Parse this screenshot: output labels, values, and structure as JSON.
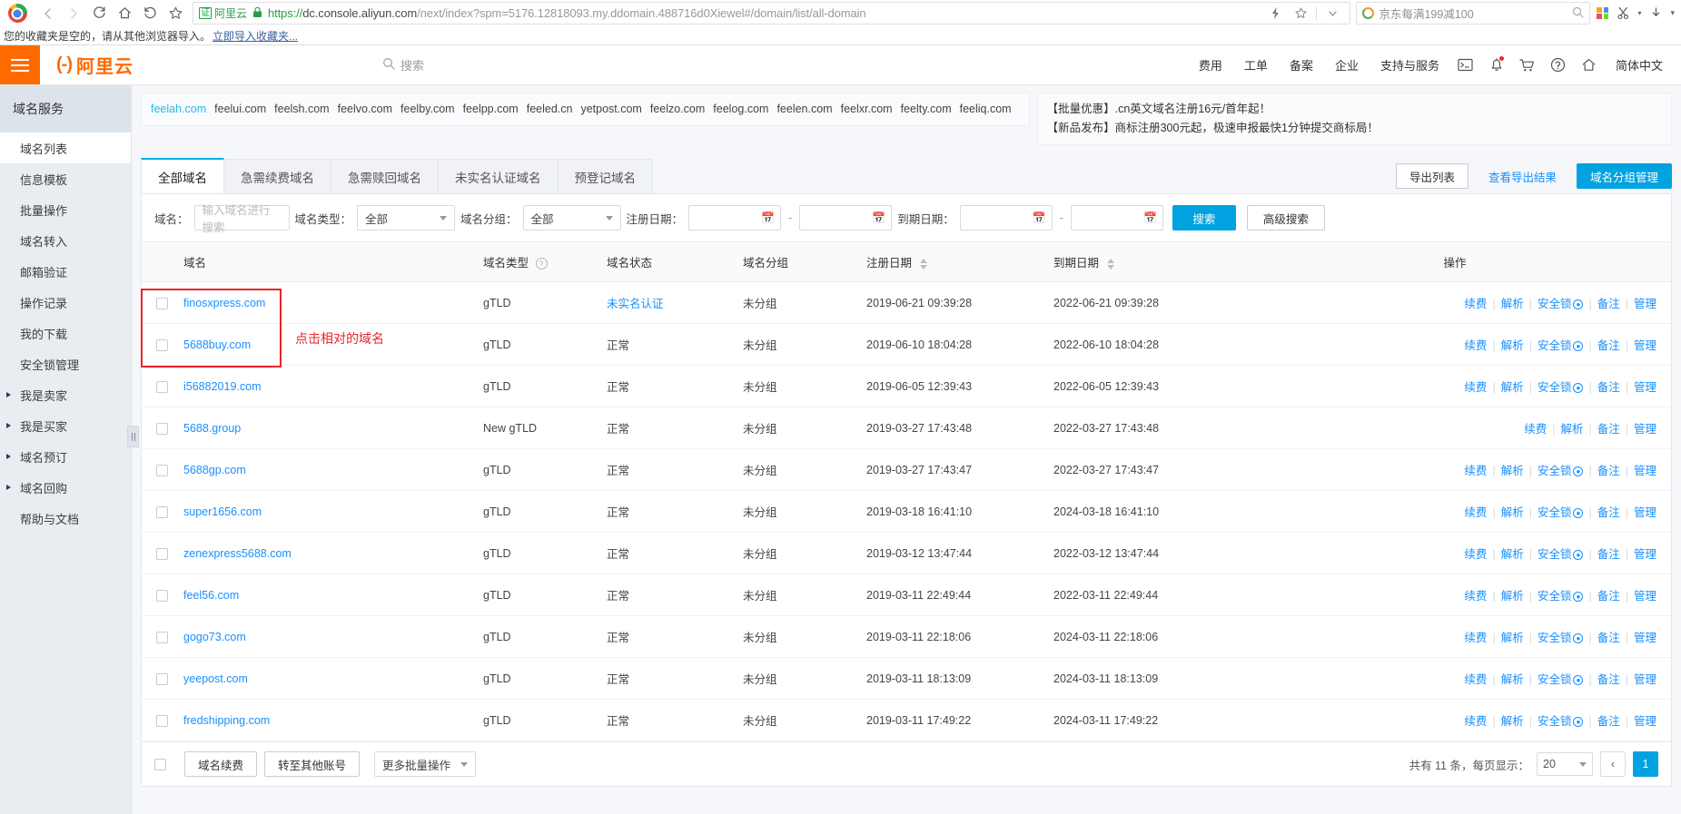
{
  "browser": {
    "back_label": "‹",
    "forward_label": "›",
    "reload_label": "⟳",
    "home_label": "⌂",
    "history_label": "↺",
    "bookmark_label": "☆",
    "cert_badge": "证",
    "cert_name": "阿里云",
    "url_scheme": "https://",
    "url_host": "dc.console.aliyun.com",
    "url_path": "/next/index?spm=5176.12818093.my.ddomain.488716d0Xiewel#/domain/list/all-domain",
    "search_box_value": "京东每满199减100",
    "bookmarks_text": "您的收藏夹是空的，请从其他浏览器导入。",
    "bookmarks_import": "立即导入收藏夹..."
  },
  "header": {
    "logo_mark": "(-)",
    "logo_text": "阿里云",
    "search_placeholder": "搜索",
    "nav_items": [
      "费用",
      "工单",
      "备案",
      "企业",
      "支持与服务"
    ],
    "icons": [
      "terminal-icon",
      "bell-icon",
      "cart-icon",
      "help-icon",
      "home-icon"
    ],
    "language": "简体中文"
  },
  "sidebar": {
    "title": "域名服务",
    "items": [
      {
        "label": "域名列表",
        "active": true,
        "expandable": false
      },
      {
        "label": "信息模板",
        "active": false,
        "expandable": false
      },
      {
        "label": "批量操作",
        "active": false,
        "expandable": false
      },
      {
        "label": "域名转入",
        "active": false,
        "expandable": false
      },
      {
        "label": "邮箱验证",
        "active": false,
        "expandable": false
      },
      {
        "label": "操作记录",
        "active": false,
        "expandable": false
      },
      {
        "label": "我的下载",
        "active": false,
        "expandable": false
      },
      {
        "label": "安全锁管理",
        "active": false,
        "expandable": false
      },
      {
        "label": "我是卖家",
        "active": false,
        "expandable": true
      },
      {
        "label": "我是买家",
        "active": false,
        "expandable": true
      },
      {
        "label": "域名预订",
        "active": false,
        "expandable": true
      },
      {
        "label": "域名回购",
        "active": false,
        "expandable": true
      },
      {
        "label": "帮助与文档",
        "active": false,
        "expandable": false
      }
    ]
  },
  "promo": {
    "domain_chips": [
      "feelah.com",
      "feelui.com",
      "feelsh.com",
      "feelvo.com",
      "feelby.com",
      "feelpp.com",
      "feeled.cn",
      "yetpost.com",
      "feelzo.com",
      "feelog.com",
      "feelen.com",
      "feelxr.com",
      "feelty.com",
      "feeliq.com"
    ],
    "highlighted_chip": "feelah.com",
    "notices": [
      "【批量优惠】.cn英文域名注册16元/首年起！",
      "【新品发布】商标注册300元起，极速申报最快1分钟提交商标局！"
    ]
  },
  "tabs": [
    {
      "label": "全部域名",
      "active": true
    },
    {
      "label": "急需续费域名",
      "active": false
    },
    {
      "label": "急需赎回域名",
      "active": false
    },
    {
      "label": "未实名认证域名",
      "active": false
    },
    {
      "label": "预登记域名",
      "active": false
    }
  ],
  "tab_actions": {
    "export_list": "导出列表",
    "view_export_result": "查看导出结果",
    "domain_group_manage": "域名分组管理"
  },
  "filters": {
    "domain_label": "域名：",
    "domain_placeholder": "输入域名进行搜索",
    "type_label": "域名类型：",
    "type_value": "全部",
    "group_label": "域名分组：",
    "group_value": "全部",
    "reg_date_label": "注册日期：",
    "exp_date_label": "到期日期：",
    "date_separator": "-",
    "search_button": "搜索",
    "advanced_button": "高级搜索"
  },
  "table": {
    "columns": [
      "域名",
      "域名类型",
      "域名状态",
      "域名分组",
      "注册日期",
      "到期日期",
      "操作"
    ],
    "ops_labels": {
      "renew": "续费",
      "resolve": "解析",
      "seclock": "安全锁",
      "remark": "备注",
      "manage": "管理"
    },
    "rows": [
      {
        "domain": "finosxpress.com",
        "type": "gTLD",
        "status": "未实名认证",
        "status_link": true,
        "group": "未分组",
        "reg": "2019-06-21 09:39:28",
        "exp": "2022-06-21 09:39:28",
        "has_seclock": true
      },
      {
        "domain": "5688buy.com",
        "type": "gTLD",
        "status": "正常",
        "status_link": false,
        "group": "未分组",
        "reg": "2019-06-10 18:04:28",
        "exp": "2022-06-10 18:04:28",
        "has_seclock": true
      },
      {
        "domain": "i56882019.com",
        "type": "gTLD",
        "status": "正常",
        "status_link": false,
        "group": "未分组",
        "reg": "2019-06-05 12:39:43",
        "exp": "2022-06-05 12:39:43",
        "has_seclock": true
      },
      {
        "domain": "5688.group",
        "type": "New gTLD",
        "status": "正常",
        "status_link": false,
        "group": "未分组",
        "reg": "2019-03-27 17:43:48",
        "exp": "2022-03-27 17:43:48",
        "has_seclock": false
      },
      {
        "domain": "5688gp.com",
        "type": "gTLD",
        "status": "正常",
        "status_link": false,
        "group": "未分组",
        "reg": "2019-03-27 17:43:47",
        "exp": "2022-03-27 17:43:47",
        "has_seclock": true
      },
      {
        "domain": "super1656.com",
        "type": "gTLD",
        "status": "正常",
        "status_link": false,
        "group": "未分组",
        "reg": "2019-03-18 16:41:10",
        "exp": "2024-03-18 16:41:10",
        "has_seclock": true
      },
      {
        "domain": "zenexpress5688.com",
        "type": "gTLD",
        "status": "正常",
        "status_link": false,
        "group": "未分组",
        "reg": "2019-03-12 13:47:44",
        "exp": "2022-03-12 13:47:44",
        "has_seclock": true
      },
      {
        "domain": "feel56.com",
        "type": "gTLD",
        "status": "正常",
        "status_link": false,
        "group": "未分组",
        "reg": "2019-03-11 22:49:44",
        "exp": "2022-03-11 22:49:44",
        "has_seclock": true
      },
      {
        "domain": "gogo73.com",
        "type": "gTLD",
        "status": "正常",
        "status_link": false,
        "group": "未分组",
        "reg": "2019-03-11 22:18:06",
        "exp": "2024-03-11 22:18:06",
        "has_seclock": true
      },
      {
        "domain": "yeepost.com",
        "type": "gTLD",
        "status": "正常",
        "status_link": false,
        "group": "未分组",
        "reg": "2019-03-11 18:13:09",
        "exp": "2024-03-11 18:13:09",
        "has_seclock": true
      },
      {
        "domain": "fredshipping.com",
        "type": "gTLD",
        "status": "正常",
        "status_link": false,
        "group": "未分组",
        "reg": "2019-03-11 17:49:22",
        "exp": "2024-03-11 17:49:22",
        "has_seclock": true
      }
    ]
  },
  "footer": {
    "batch_renew": "域名续费",
    "transfer_account": "转至其他账号",
    "more_batch": "更多批量操作",
    "total_text": "共有 11 条，每页显示：",
    "page_size": "20",
    "page_current": "1"
  },
  "annotation": {
    "text": "点击相对的域名",
    "color": "#e8252a"
  },
  "colors": {
    "brand_orange": "#ff6a00",
    "accent_blue": "#00a2e0",
    "link_blue": "#1890ff",
    "annotation_red": "#e8252a"
  }
}
